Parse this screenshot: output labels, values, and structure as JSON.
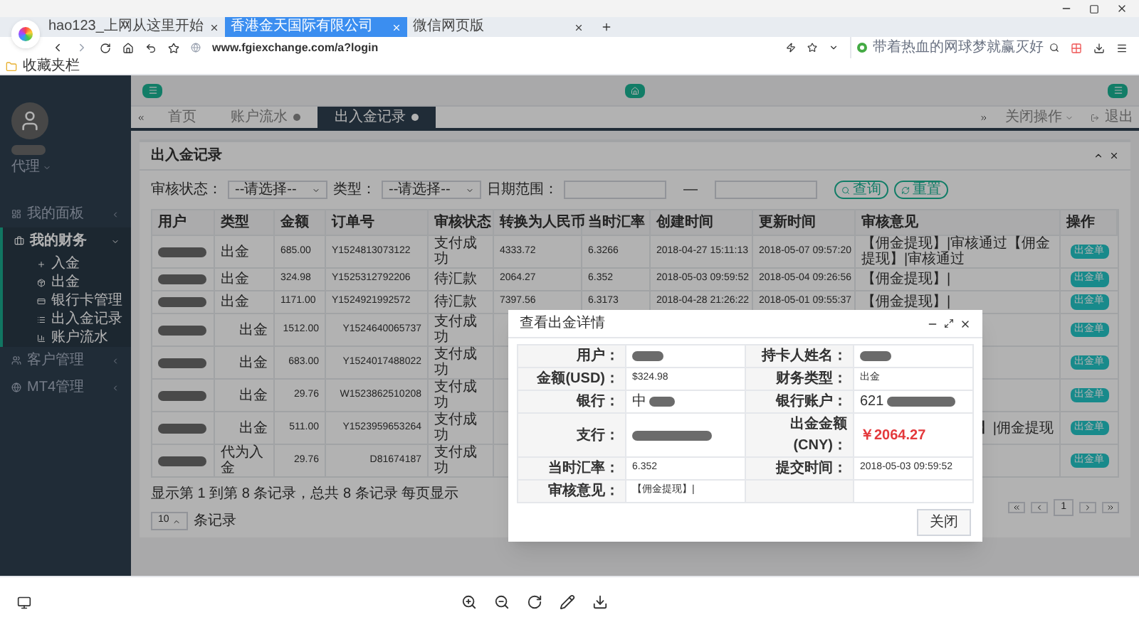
{
  "browser": {
    "tabs": [
      {
        "label": "hao123_上网从这里开始",
        "selected": false
      },
      {
        "label": "香港金天国际有限公司",
        "selected": true
      },
      {
        "label": "微信网页版",
        "selected": false
      }
    ],
    "address": "www.fgiexchange.com/a?login",
    "search_placeholder": "带着热血的网球梦就赢灭好",
    "bookmark": "收藏夹栏"
  },
  "sidebar": {
    "role": "代理",
    "items": [
      {
        "label": "我的面板",
        "expanded": false
      },
      {
        "label": "我的财务",
        "expanded": true,
        "children": [
          {
            "label": "入金"
          },
          {
            "label": "出金"
          },
          {
            "label": "银行卡管理"
          },
          {
            "label": "出入金记录"
          },
          {
            "label": "账户流水"
          }
        ]
      },
      {
        "label": "客户管理",
        "expanded": false
      },
      {
        "label": "MT4管理",
        "expanded": false
      }
    ]
  },
  "tabs": [
    {
      "label": "首页",
      "selected": false,
      "closable": false
    },
    {
      "label": "账户流水",
      "selected": false,
      "closable": true
    },
    {
      "label": "出入金记录",
      "selected": true,
      "closable": true
    }
  ],
  "tab_actions": {
    "close_ops": "关闭操作",
    "logout": "退出"
  },
  "panel": {
    "title": "出入金记录",
    "filters": {
      "status_label": "审核状态：",
      "status_value": "--请选择--",
      "type_label": "类型：",
      "type_value": "--请选择--",
      "date_label": "日期范围：",
      "date_sep": "—",
      "search": "查询",
      "reset": "重置"
    },
    "columns": [
      "用户",
      "类型",
      "金额",
      "订单号",
      "审核状态",
      "转换为人民币",
      "当时汇率",
      "创建时间",
      "更新时间",
      "审核意见",
      "操作"
    ],
    "rows": [
      {
        "type": "出金",
        "amount": "685.00",
        "order_no": "Y1524813073122",
        "status": "支付成功",
        "cny": "4333.72",
        "rate": "6.3266",
        "created": "2018-04-27 15:11:13",
        "updated": "2018-05-07 09:57:20",
        "review": "【佣金提现】|审核通过【佣金提现】|审核通过",
        "action": "出金单"
      },
      {
        "type": "出金",
        "amount": "324.98",
        "order_no": "Y1525312792206",
        "status": "待汇款",
        "cny": "2064.27",
        "rate": "6.352",
        "created": "2018-05-03 09:59:52",
        "updated": "2018-05-04 09:26:56",
        "review": "【佣金提现】|",
        "action": "出金单"
      },
      {
        "type": "出金",
        "amount": "1171.00",
        "order_no": "Y1524921992572",
        "status": "待汇款",
        "cny": "7397.56",
        "rate": "6.3173",
        "created": "2018-04-28 21:26:22",
        "updated": "2018-05-01 09:55:37",
        "review": "【佣金提现】|",
        "action": "出金单"
      },
      {
        "type": "出金",
        "amount": "1512.00",
        "order_no": "Y1524640065737",
        "status": "支付成功",
        "action": "出金单"
      },
      {
        "type": "出金",
        "amount": "683.00",
        "order_no": "Y1524017488022",
        "status": "支付成功",
        "action": "出金单"
      },
      {
        "type": "出金",
        "amount": "29.76",
        "order_no": "W1523862510208",
        "status": "支付成功",
        "action": "出金单"
      },
      {
        "type": "出金",
        "amount": "511.00",
        "order_no": "Y1523959653264",
        "status": "支付成功",
        "review": "】|佣金提现",
        "action": "出金单"
      },
      {
        "type": "代为入金",
        "amount": "29.76",
        "order_no": "D81674187",
        "status": "支付成功",
        "action": "出金单"
      }
    ],
    "footer": {
      "summary": "显示第 1 到第 8 条记录，总共 8 条记录 每页显示",
      "page_size": "10",
      "suffix": "条记录",
      "page": "1"
    }
  },
  "modal": {
    "title": "查看出金详情",
    "fields": [
      {
        "label": "用户：",
        "kind": "redacted"
      },
      {
        "label": "持卡人姓名：",
        "kind": "redacted"
      },
      {
        "label": "金额(USD)：",
        "kind": "text",
        "value": "$324.98"
      },
      {
        "label": "财务类型：",
        "kind": "text",
        "value": "出金"
      },
      {
        "label": "银行：",
        "kind": "partial",
        "value": "中"
      },
      {
        "label": "银行账户：",
        "kind": "partial",
        "value": "621"
      },
      {
        "label": "支行：",
        "kind": "redacted"
      },
      {
        "label": "出金金额(CNY)：",
        "kind": "highlight",
        "value": "￥2064.27"
      },
      {
        "label": "当时汇率：",
        "kind": "text",
        "value": "6.352"
      },
      {
        "label": "提交时间：",
        "kind": "text",
        "value": "2018-05-03 09:59:52"
      },
      {
        "label": "审核意见：",
        "kind": "text",
        "value": "【佣金提现】|"
      },
      {
        "kind": "empty"
      }
    ],
    "close": "关闭"
  }
}
